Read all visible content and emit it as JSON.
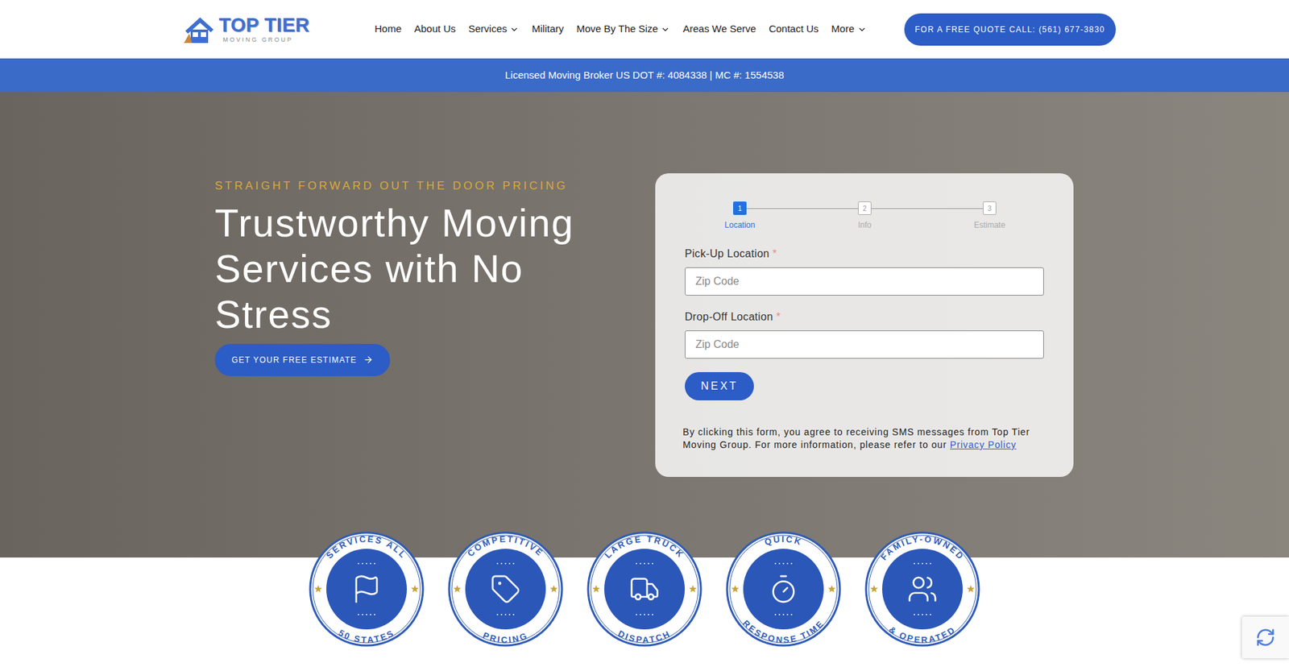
{
  "header": {
    "logo": {
      "name": "TOP TIER",
      "subtitle": "MOVING GROUP"
    },
    "nav": [
      {
        "label": "Home",
        "has_dropdown": false
      },
      {
        "label": "About Us",
        "has_dropdown": false
      },
      {
        "label": "Services",
        "has_dropdown": true
      },
      {
        "label": "Military",
        "has_dropdown": false
      },
      {
        "label": "Move By The Size",
        "has_dropdown": true
      },
      {
        "label": "Areas We Serve",
        "has_dropdown": false
      },
      {
        "label": "Contact Us",
        "has_dropdown": false
      },
      {
        "label": "More",
        "has_dropdown": true
      }
    ],
    "cta": "FOR A FREE QUOTE CALL: (561) 677-3830"
  },
  "license_bar": "Licensed Moving Broker US DOT #: 4084338 | MC #: 1554538",
  "hero": {
    "tagline": "STRAIGHT FORWARD OUT THE DOOR PRICING",
    "heading": "Trustworthy Moving Services with No Stress",
    "button": "GET YOUR FREE ESTIMATE"
  },
  "form": {
    "steps": [
      {
        "number": "1",
        "label": "Location",
        "selected": true
      },
      {
        "number": "2",
        "label": "Info",
        "selected": false
      },
      {
        "number": "3",
        "label": "Estimate",
        "selected": false
      }
    ],
    "fields": [
      {
        "label": "Pick-Up Location",
        "required_mark": "*",
        "placeholder": "Zip Code"
      },
      {
        "label": "Drop-Off Location",
        "required_mark": "*",
        "placeholder": "Zip Code"
      }
    ],
    "next": "NEXT",
    "disclaimer": "By clicking this form, you agree to receiving SMS messages from Top Tier Moving Group. For more information, please refer to our",
    "link": "Privacy Policy"
  },
  "badges": [
    {
      "top": "SERVICES ALL",
      "bottom": "50 STATES"
    },
    {
      "top": "COMPETITIVE",
      "bottom": "PRICING"
    },
    {
      "top": "LARGE TRUCK",
      "bottom": "DISPATCH"
    },
    {
      "top": "QUICK",
      "bottom": "RESPONSE TIME"
    },
    {
      "top": "FAMILY-OWNED",
      "bottom": "& OPERATED"
    }
  ]
}
